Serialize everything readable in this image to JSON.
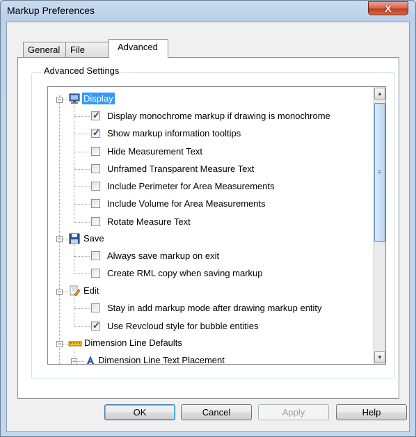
{
  "window": {
    "title": "Markup Preferences",
    "close_glyph": "X"
  },
  "tabs": [
    {
      "label": "General"
    },
    {
      "label": "File"
    },
    {
      "label": "Advanced",
      "active": true
    }
  ],
  "group": {
    "label": "Advanced Settings"
  },
  "tree": {
    "display": {
      "label": "Display",
      "items": [
        {
          "label": "Display monochrome markup if drawing is monochrome",
          "checked": true
        },
        {
          "label": "Show markup information tooltips",
          "checked": true
        },
        {
          "label": "Hide Measurement Text",
          "checked": false
        },
        {
          "label": "Unframed Transparent Measure Text",
          "checked": false
        },
        {
          "label": "Include Perimeter for Area Measurements",
          "checked": false
        },
        {
          "label": "Include Volume for Area Measurements",
          "checked": false
        },
        {
          "label": "Rotate Measure Text",
          "checked": false
        }
      ]
    },
    "save": {
      "label": "Save",
      "items": [
        {
          "label": "Always save markup on exit",
          "checked": false
        },
        {
          "label": "Create RML copy when saving markup",
          "checked": false
        }
      ]
    },
    "edit": {
      "label": "Edit",
      "items": [
        {
          "label": "Stay in add markup mode after drawing markup entity",
          "checked": false
        },
        {
          "label": "Use Revcloud style for bubble entities",
          "checked": true
        }
      ]
    },
    "dimension": {
      "label": "Dimension Line Defaults",
      "items": [
        {
          "label": "Dimension Line Text Placement"
        }
      ]
    }
  },
  "buttons": {
    "ok": "OK",
    "cancel": "Cancel",
    "apply": "Apply",
    "help": "Help"
  },
  "colors": {
    "selection": "#3399ff",
    "check": "#2a3e8c"
  }
}
